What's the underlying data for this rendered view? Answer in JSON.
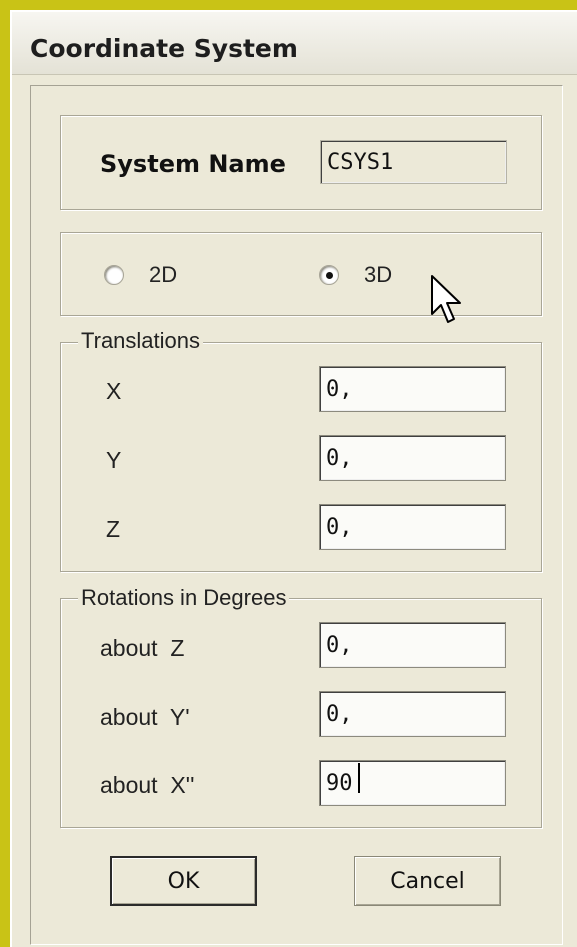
{
  "window": {
    "title": "Coordinate System"
  },
  "system_name": {
    "label": "System Name",
    "value": "CSYS1"
  },
  "dimension": {
    "options": [
      {
        "label": "2D",
        "checked": false
      },
      {
        "label": "3D",
        "checked": true
      }
    ]
  },
  "translations": {
    "legend": "Translations",
    "fields": [
      {
        "label": "X",
        "value": "0,"
      },
      {
        "label": "Y",
        "value": "0,"
      },
      {
        "label": "Z",
        "value": "0,"
      }
    ]
  },
  "rotations": {
    "legend": "Rotations in Degrees",
    "fields": [
      {
        "label": "about  Z",
        "value": "0,"
      },
      {
        "label": "about  Y'",
        "value": "0,"
      },
      {
        "label": "about  X''",
        "value": "90"
      }
    ]
  },
  "buttons": {
    "ok": "OK",
    "cancel": "Cancel"
  },
  "colors": {
    "background": "#c9c316",
    "dialog": "#ece9d8"
  },
  "icons": {
    "pointer": "mouse-pointer-icon"
  }
}
